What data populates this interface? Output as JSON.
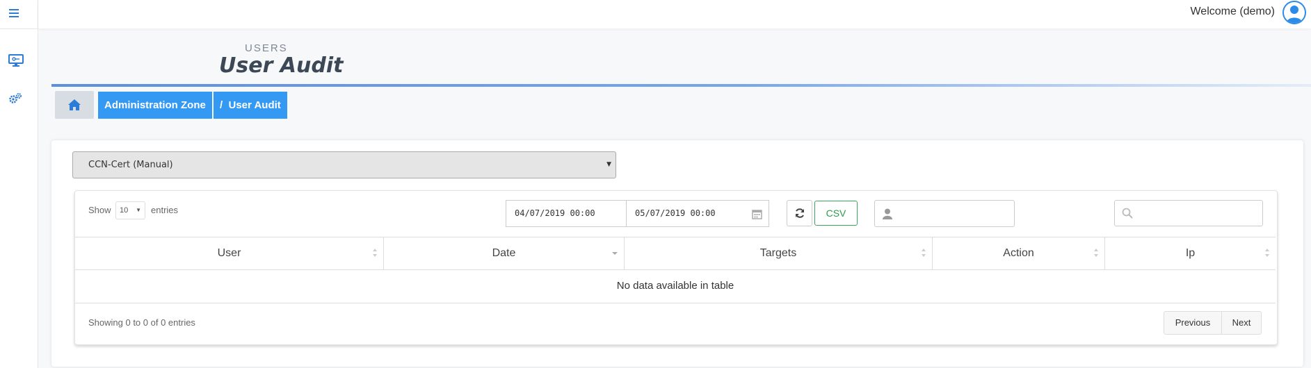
{
  "header": {
    "welcome": "Welcome (demo)"
  },
  "sidebar": {
    "items": [
      {
        "icon": "monitor-key-icon"
      },
      {
        "icon": "gears-icon"
      }
    ]
  },
  "page": {
    "kicker": "USERS",
    "title": "User Audit"
  },
  "breadcrumb": {
    "home_icon": "home-icon",
    "items": [
      "Administration Zone",
      "/  User Audit"
    ]
  },
  "filter": {
    "source_selected": "CCN-Cert (Manual)"
  },
  "table_controls": {
    "show_label": "Show",
    "page_length": "10",
    "entries_label": "entries",
    "date_from": "04/07/2019 00:00",
    "date_to": "05/07/2019 00:00",
    "csv_label": "CSV",
    "user_placeholder": "",
    "search_placeholder": ""
  },
  "table": {
    "columns": [
      "User",
      "Date",
      "Targets",
      "Action",
      "Ip"
    ],
    "empty_message": "No data available in table",
    "info": "Showing 0 to 0 of 0 entries",
    "pagination": {
      "previous": "Previous",
      "next": "Next"
    }
  },
  "colors": {
    "primary": "#3399f3",
    "csv_green": "#2e9a4e",
    "title": "#3d4856"
  }
}
